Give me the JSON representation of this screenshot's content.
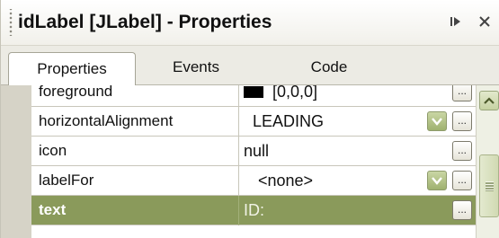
{
  "title": "idLabel [JLabel] - Properties",
  "title_buttons": {
    "pin_icon": "pin-icon",
    "close_icon": "close-icon"
  },
  "tabs": [
    {
      "label": "Properties",
      "active": true
    },
    {
      "label": "Events",
      "active": false
    },
    {
      "label": "Code",
      "active": false
    }
  ],
  "properties": [
    {
      "name": "foreground",
      "value": "[0,0,0]",
      "has_color_swatch": true,
      "swatch_color": "#000000",
      "has_combo": false,
      "selected": false
    },
    {
      "name": "horizontalAlignment",
      "value": "LEADING",
      "has_color_swatch": false,
      "has_combo": true,
      "selected": false
    },
    {
      "name": "icon",
      "value": "null",
      "has_color_swatch": false,
      "has_combo": false,
      "selected": false
    },
    {
      "name": "labelFor",
      "value": "<none>",
      "has_color_swatch": false,
      "has_combo": true,
      "selected": false
    },
    {
      "name": "text",
      "value": "ID:",
      "has_color_swatch": false,
      "has_combo": false,
      "selected": true
    }
  ],
  "ellipsis_label": "...",
  "colors": {
    "selected_row": "#8a9a5b",
    "gutter": "#d6d3c7",
    "combo_accent": "#9fb16f"
  }
}
